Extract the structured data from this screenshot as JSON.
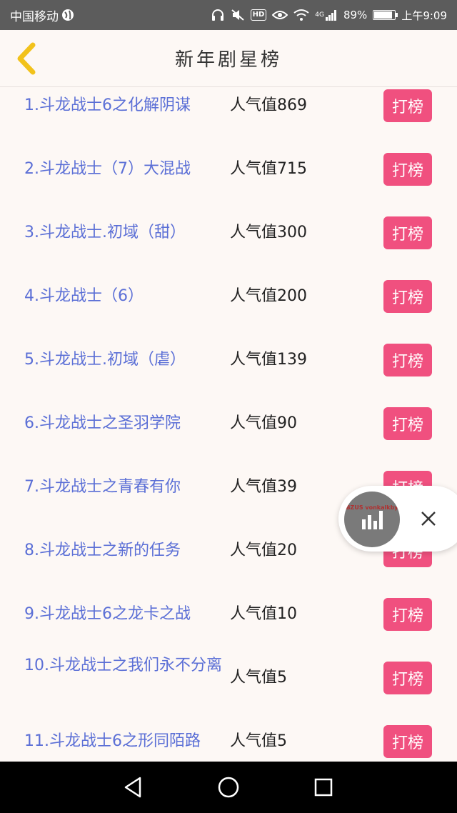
{
  "status_bar": {
    "carrier": "中国移动",
    "signal_label": "4G",
    "battery_percent": "89%",
    "battery_level": 0.89,
    "time": "上午9:09",
    "hd_label": "HD"
  },
  "header": {
    "title": "新年剧星榜"
  },
  "ranking": {
    "score_prefix": "人气值",
    "button_label": "打榜",
    "items": [
      {
        "name": "1.斗龙战士6之化解阴谋",
        "score": "人气值869",
        "button": "打榜"
      },
      {
        "name": "2.斗龙战士（7）大混战",
        "score": "人气值715",
        "button": "打榜"
      },
      {
        "name": "3.斗龙战士.初域（甜）",
        "score": "人气值300",
        "button": "打榜"
      },
      {
        "name": "4.斗龙战士（6）",
        "score": "人气值200",
        "button": "打榜"
      },
      {
        "name": "5.斗龙战士.初域（虐）",
        "score": "人气值139",
        "button": "打榜"
      },
      {
        "name": "6.斗龙战士之圣羽学院",
        "score": "人气值90",
        "button": "打榜"
      },
      {
        "name": "7.斗龙战士之青春有你",
        "score": "人气值39",
        "button": "打榜"
      },
      {
        "name": "8.斗龙战士之新的任务",
        "score": "人气值20",
        "button": "打榜"
      },
      {
        "name": "9.斗龙战士6之龙卡之战",
        "score": "人气值10",
        "button": "打榜"
      },
      {
        "name": "10.斗龙战士之我们永不分离",
        "score": "人气值5",
        "button": "打榜"
      },
      {
        "name": "11.斗龙战士6之形同陌路",
        "score": "人气值5",
        "button": "打榜"
      }
    ]
  },
  "float_widget": {
    "ball_text": "BZUS vonkalkby"
  },
  "colors": {
    "link_blue": "#5b6fd6",
    "button_pink": "#f0507f",
    "back_yellow": "#f2c21b",
    "background": "#fdf8f5"
  }
}
